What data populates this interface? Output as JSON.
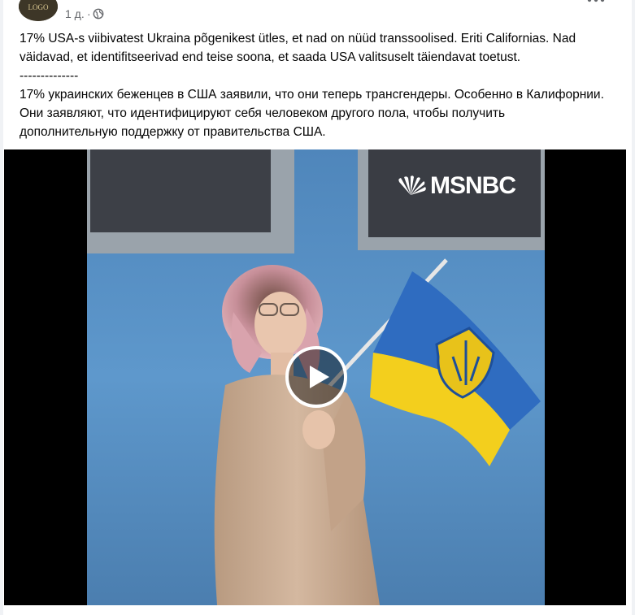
{
  "post": {
    "time": "1 д.",
    "separator": "·",
    "visibility_icon": "globe-icon",
    "more_icon": "more-horizontal-icon",
    "text_et": "17% USA-s viibivatest Ukraina põgenikest ütles, et nad on nüüd transsoolised. Eriti Californias. Nad väidavad, et identifitseerivad end teise soona, et saada USA valitsuselt täiendavat toetust.",
    "divider": "--------------",
    "text_ru": "17% украинских беженцев в США заявили, что они теперь трансгендеры. Особенно в Калифорнии. Они заявляют, что идентифицируют себя человеком другого пола, чтобы получить дополнительную поддержку от правительства США."
  },
  "video": {
    "logo_text": "MSNBC",
    "logo_icon": "peacock-icon",
    "play_icon": "play-icon",
    "colors": {
      "wall": "#5b95c8",
      "flag_blue": "#2f6cc0",
      "flag_yellow": "#f3cf1d",
      "sweater": "#c8ab92",
      "hair": "#d7a2a8"
    }
  }
}
